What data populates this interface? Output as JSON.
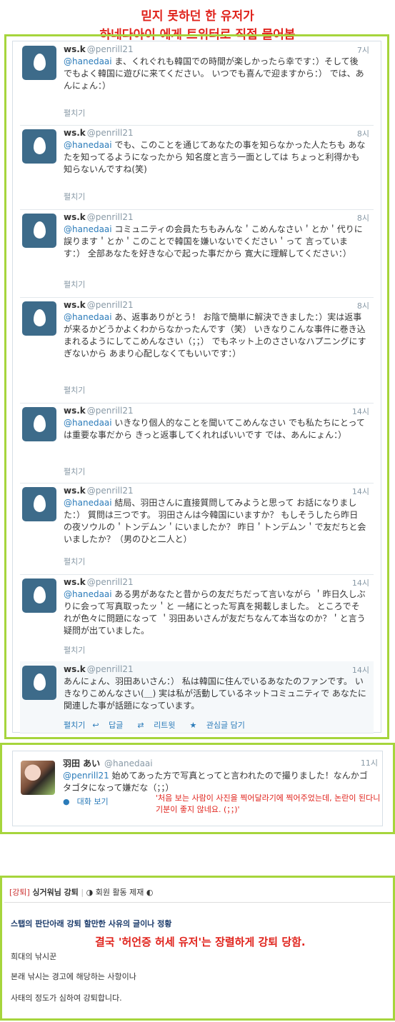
{
  "captions": {
    "line1": "믿지 못하던 한 유저가",
    "line2": "하네다아이 에게 트위터로 직접 물어봄"
  },
  "tweets": [
    {
      "name": "ws.k",
      "handle": "@penrill21",
      "time": "7시",
      "mention": "@hanedaai",
      "text": " ま、くれぐれも韓国での時間が楽しかったら幸です：）そして後でもよく韓国に遊びに来てください。 いつでも喜んで迎ますから：） では、あんにょん：）",
      "expand": "펼치기"
    },
    {
      "name": "ws.k",
      "handle": "@penrill21",
      "time": "8시",
      "mention": "@hanedaai",
      "text": " でも、このことを通じてあなたの事を知らなかった人たちも あなたを知ってるようになったから 知名度と言う一面としては ちょっと利得かも知らないんですね(笑)",
      "expand": "펼치기"
    },
    {
      "name": "ws.k",
      "handle": "@penrill21",
      "time": "8시",
      "mention": "@hanedaai",
      "text": " コミュニティの会員たちもみんな＇こめんなさい＇とか＇代りに誤ります＇とか＇このことで韓国を嫌いないでください＇って 言っています：） 全部あなたを好きな心で起った事だから 寛大に理解してください：）",
      "expand": "펼치기"
    },
    {
      "name": "ws.k",
      "handle": "@penrill21",
      "time": "8시",
      "mention": "@hanedaai",
      "text": " あ、返事ありがとう！ お陰で簡単に解決できました：）実は返事が来るかどうかよくわからなかったんです（笑） いきなりこんな事件に巻き込まれるようにしてこめんなさい（；；） でもネット上のささいなハプニングにすぎないから あまり心配しなくてもいいです：）",
      "expand": "펼치기"
    },
    {
      "name": "ws.k",
      "handle": "@penrill21",
      "time": "14시",
      "mention": "@hanedaai",
      "text": " いきなり個人的なことを聞いてこめんなさい でも私たちにとっては重要な事だから きっと返事してくれればいいです では、あんにょん：）",
      "expand": "펼치기"
    },
    {
      "name": "ws.k",
      "handle": "@penrill21",
      "time": "14시",
      "mention": "@hanedaai",
      "text": " 結局、羽田さんに直接質問してみようと思って お話になりました：） 質問は三つです。 羽田さんは今韓国にいますか？ もしそうしたら昨日の夜ソウルの＇トンデムン＇にいましたか？ 昨日＇トンデムン＇で友だちと会いましたか？（男のひと二人と）",
      "expand": "펼치기"
    },
    {
      "name": "ws.k",
      "handle": "@penrill21",
      "time": "14시",
      "mention": "@hanedaai",
      "text": " ある男があなたと昔からの友だちだって言いながら ＇昨日久しぶりに会って写真取ったッ＇と 一緒にとった写真を掲載しました。 ところでそれが色々に問題になって ＇羽田あいさんが友だちなんて本当なのか？＇と言う疑問が出ていました。",
      "expand": "펼치기"
    },
    {
      "name": "ws.k",
      "handle": "@penrill21",
      "time": "14시",
      "mention": "",
      "text": "あんにょん、羽田あいさん：） 私は韓国に住んでいるあなたのファンです。 いきなりこめんなさい(＿) 実は私が活動しているネットコミュニティで あなたに関連した事が話題になっています。",
      "expand": "펼치기"
    }
  ],
  "actions": {
    "reply": "답글",
    "retweet": "리트윗",
    "favorite": "관심글 담기"
  },
  "icons": {
    "reply": "reply-icon",
    "retweet": "retweet-icon",
    "favorite": "star-icon",
    "conversation": "conversation-icon"
  },
  "reply_tweet": {
    "name": "羽田 あい",
    "handle": "@hanedaai",
    "time": "11시",
    "mention": "@penrill21",
    "text": " 始めてあった方で写真とってと言われたので撮りました！なんかゴタゴタになって嫌だな（；；）",
    "conversation": "대화 보기",
    "note": "'처음 보는 사람이 사진을 찍어달라기에 찍어주었는데, 논란이 된다니 기분이 좋지 않네요. (；；)'"
  },
  "ban": {
    "tag": "[강퇴]",
    "title": "싱거워님 강퇴",
    "status": "◑ 회원 활동 제재 ◐",
    "heading": "스탭의 판단아래 강퇴 할만한 사유의 글이나 정황",
    "note": "결국 '허언증 허세 유저'는 장렬하게 강퇴 당함.",
    "lines": [
      "희대의 낚시꾼",
      "본래 낚시는 경고에 해당하는 사항이나",
      "사태의 정도가 심하여 강퇴합니다."
    ]
  },
  "colors": {
    "frame": "#a6d53c",
    "caption": "#e0231c",
    "link": "#2b7bb9",
    "avatar": "#3d6b8a"
  }
}
